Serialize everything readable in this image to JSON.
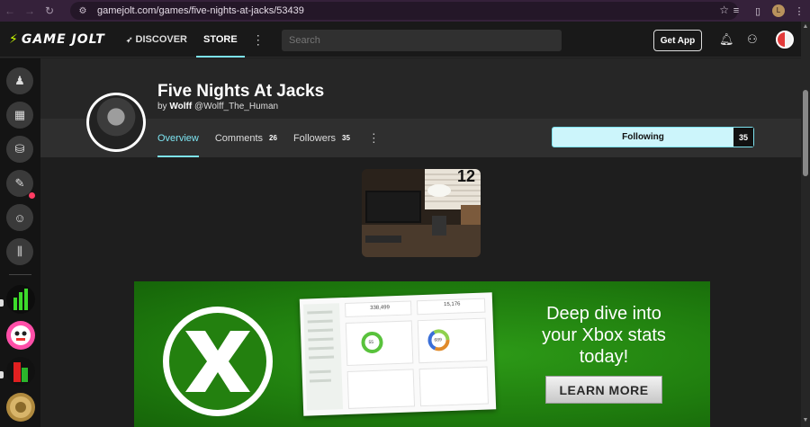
{
  "browser": {
    "url": "gamejolt.com/games/five-nights-at-jacks/53439",
    "profile_initial": "L"
  },
  "topbar": {
    "logo_text": "GAME JOLT",
    "nav": [
      {
        "label": "DISCOVER",
        "active": false
      },
      {
        "label": "STORE",
        "active": true
      }
    ],
    "search_placeholder": "Search",
    "get_app_label": "Get App"
  },
  "game": {
    "title": "Five Nights At Jacks",
    "by_label": "by",
    "author_name": "Wolff",
    "author_handle": "@Wolff_The_Human",
    "tabs": [
      {
        "label": "Overview",
        "count": null,
        "active": true
      },
      {
        "label": "Comments",
        "count": "26",
        "active": false
      },
      {
        "label": "Followers",
        "count": "35",
        "active": false
      }
    ],
    "follow_label": "Following",
    "follow_count": "35",
    "thumbnail_number": "12"
  },
  "ad": {
    "headline_lines": [
      "Deep dive into",
      "your Xbox stats",
      "today!"
    ],
    "button_label": "LEARN MORE",
    "shot_values": [
      "338,499",
      "15,176",
      "55",
      "689"
    ]
  },
  "colors": {
    "accent": "#7de3f0",
    "follow_bg": "#ccf5fb",
    "ad_green": "#1f7c0e",
    "notify": "#ff3c63"
  }
}
